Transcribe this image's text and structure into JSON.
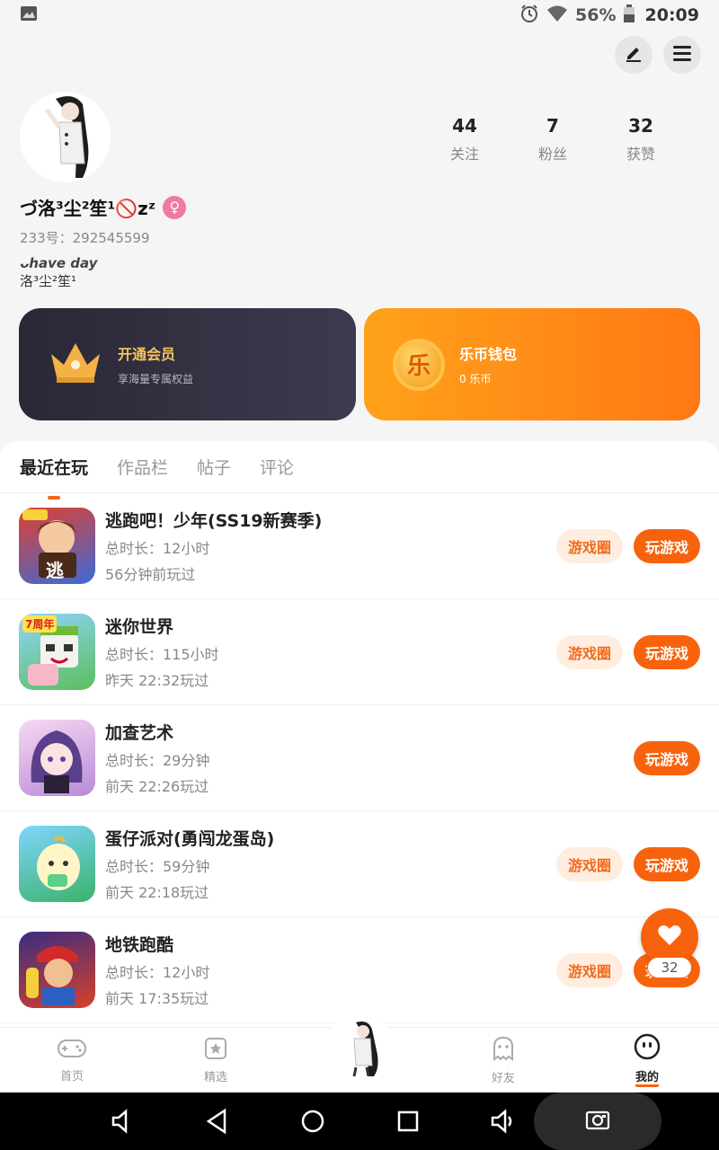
{
  "status_bar": {
    "battery_percent": "56%",
    "time": "20:09"
  },
  "profile": {
    "following_count": "44",
    "following_label": "关注",
    "fans_count": "7",
    "fans_label": "粉丝",
    "likes_count": "32",
    "likes_label": "获赞",
    "nickname": "づ洛³尘²笙¹🚫zᶻ",
    "uid": "233号：292545599",
    "bio_line1": "ᴗhave  day",
    "bio_line2": "洛³尘²笙¹"
  },
  "cards": {
    "vip_title": "开通会员",
    "vip_sub": "享海量专属权益",
    "wallet_title": "乐币钱包",
    "wallet_sub": "0 乐币",
    "coin_char": "乐"
  },
  "tabs": [
    "最近在玩",
    "作品栏",
    "帖子",
    "评论"
  ],
  "games": [
    {
      "title": "逃跑吧！少年(SS19新赛季)",
      "duration": "总时长：12小时",
      "last": "56分钟前玩过",
      "circle": "游戏圈",
      "play": "玩游戏",
      "icon_char": "逃"
    },
    {
      "title": "迷你世界",
      "duration": "总时长：115小时",
      "last": "昨天 22:32玩过",
      "circle": "游戏圈",
      "play": "玩游戏",
      "icon_char": "7周年"
    },
    {
      "title": "加查艺术",
      "duration": "总时长：29分钟",
      "last": "前天 22:26玩过",
      "play": "玩游戏"
    },
    {
      "title": "蛋仔派对(勇闯龙蛋岛)",
      "duration": "总时长：59分钟",
      "last": "前天 22:18玩过",
      "circle": "游戏圈",
      "play": "玩游戏"
    },
    {
      "title": "地铁跑酷",
      "duration": "总时长：12小时",
      "last": "前天 17:35玩过",
      "circle": "游戏圈",
      "play": "玩游戏"
    }
  ],
  "favorite_count": "32",
  "bottom_nav": {
    "home": "首页",
    "featured": "精选",
    "friends": "好友",
    "me": "我的"
  },
  "colors": {
    "accent": "#f7630c",
    "vip_gold": "#f5c35a",
    "wallet_orange": "#ff8a18"
  }
}
